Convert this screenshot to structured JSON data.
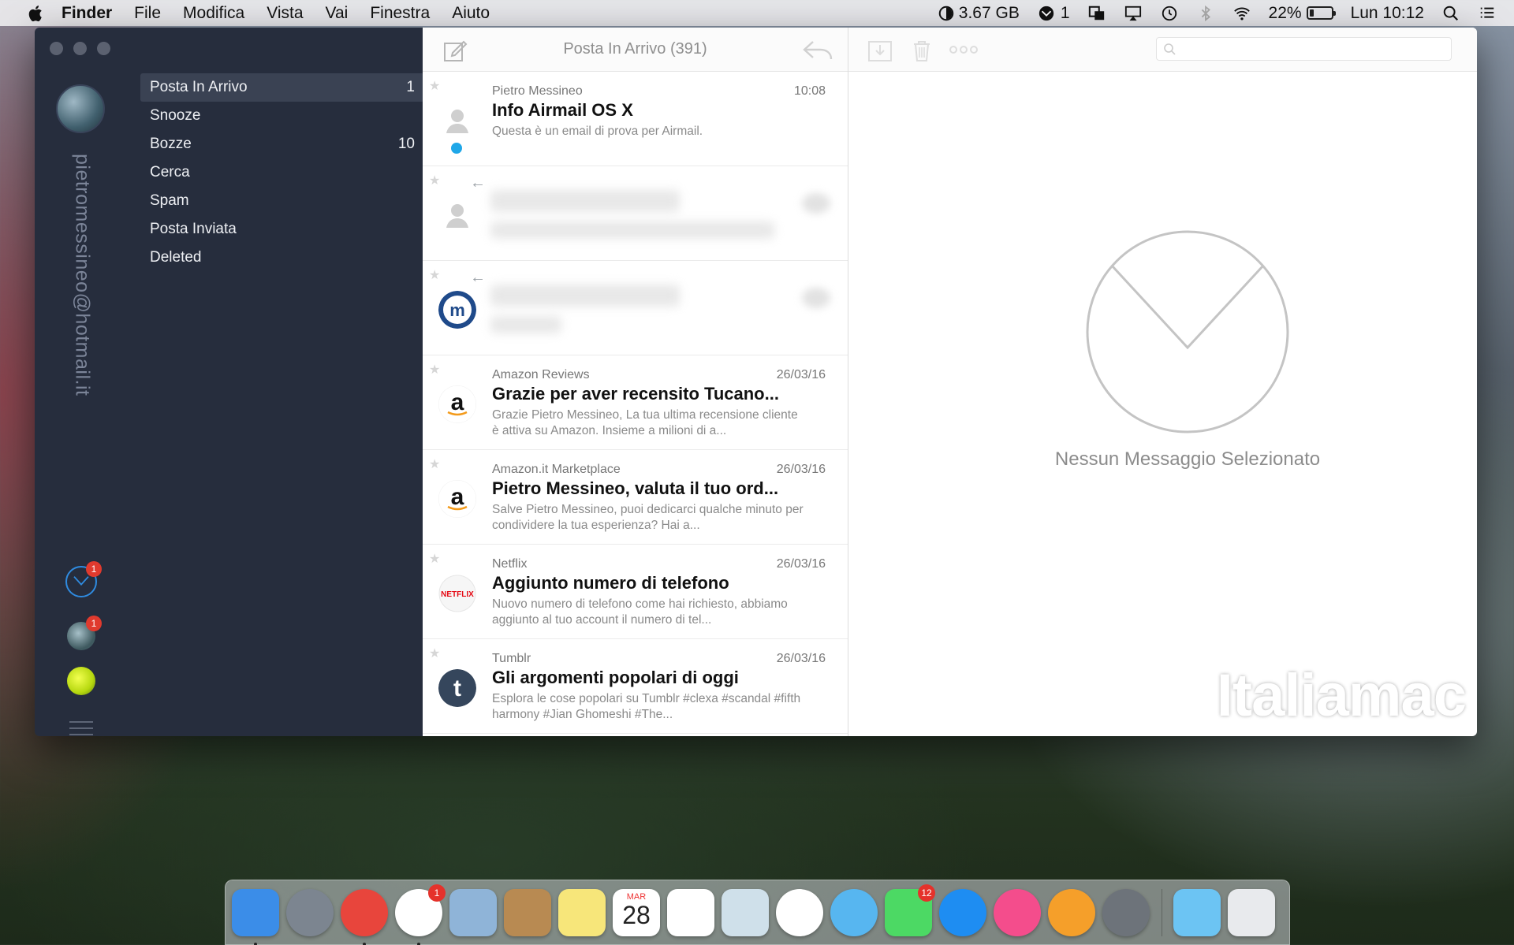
{
  "menubar": {
    "app_name": "Finder",
    "menus": [
      "File",
      "Modifica",
      "Vista",
      "Vai",
      "Finestra",
      "Aiuto"
    ],
    "memory": "3.67 GB",
    "airmail_count": "1",
    "battery": "22%",
    "battery_level": 0.22,
    "clock": "Lun 10:12",
    "icons": [
      "apple-icon",
      "memory-icon",
      "airmail-icon",
      "display-icon",
      "airplay-icon",
      "time-machine-icon",
      "bluetooth-icon",
      "wifi-icon",
      "battery-icon",
      "spotlight-icon",
      "notification-icon"
    ]
  },
  "accounts": {
    "email": "pietromessineo@hotmail.it",
    "items": [
      {
        "name": "airmail",
        "badge": "1"
      },
      {
        "name": "photo",
        "badge": "1"
      },
      {
        "name": "tennis",
        "badge": ""
      }
    ]
  },
  "folders": [
    {
      "label": "Posta In Arrivo",
      "count": "1",
      "active": true
    },
    {
      "label": "Snooze",
      "count": ""
    },
    {
      "label": "Bozze",
      "count": "10"
    },
    {
      "label": "Cerca",
      "count": ""
    },
    {
      "label": "Spam",
      "count": ""
    },
    {
      "label": "Posta Inviata",
      "count": ""
    },
    {
      "label": "Deleted",
      "count": ""
    }
  ],
  "message_list": {
    "title": "Posta In Arrivo (391)",
    "messages": [
      {
        "sender": "Pietro Messineo",
        "date": "10:08",
        "subject": "Info Airmail OS X",
        "preview": "Questa è un email di prova per Airmail.",
        "avatar": "person"
      },
      {
        "blurred": true,
        "avatar": "person"
      },
      {
        "blurred": true,
        "avatar": "logo"
      },
      {
        "sender": "Amazon Reviews",
        "date": "26/03/16",
        "subject": "Grazie per aver recensito Tucano...",
        "preview": "Grazie Pietro Messineo, La tua ultima recensione cliente è attiva su Amazon. Insieme a milioni di a...",
        "avatar": "amazon"
      },
      {
        "sender": "Amazon.it Marketplace",
        "date": "26/03/16",
        "subject": "Pietro Messineo, valuta il tuo ord...",
        "preview": "Salve Pietro Messineo, puoi dedicarci qualche minuto per condividere la tua esperienza? Hai a...",
        "avatar": "amazon"
      },
      {
        "sender": "Netflix",
        "date": "26/03/16",
        "subject": "Aggiunto numero di telefono",
        "preview": "Nuovo numero di telefono come hai richiesto, abbiamo aggiunto al tuo account il numero di tel...",
        "avatar": "netflix",
        "avatar_text": "NETFLIX"
      },
      {
        "sender": "Tumblr",
        "date": "26/03/16",
        "subject": "Gli argomenti popolari di oggi",
        "preview": "Esplora le cose popolari su Tumblr #clexa #scandal #fifth harmony #Jian Ghomeshi #The...",
        "avatar": "tumblr",
        "avatar_text": "t"
      }
    ]
  },
  "reader": {
    "empty_text": "Nessun Messaggio Selezionato",
    "watermark": "Italiamac"
  },
  "dock": {
    "items": [
      {
        "name": "finder",
        "color": "#3b8de8",
        "running": true
      },
      {
        "name": "launchpad",
        "color": "#7c8590"
      },
      {
        "name": "chrome",
        "color": "#e8453c",
        "running": true
      },
      {
        "name": "airmail",
        "color": "#ffffff",
        "badge": "1",
        "running": true
      },
      {
        "name": "mail",
        "color": "#8fb4d8"
      },
      {
        "name": "contacts",
        "color": "#b88a52"
      },
      {
        "name": "notes",
        "color": "#f7e67a"
      },
      {
        "name": "calendar",
        "color": "#ffffff",
        "month": "MAR",
        "day": "28"
      },
      {
        "name": "reminders",
        "color": "#ffffff"
      },
      {
        "name": "preview",
        "color": "#cfe0ea"
      },
      {
        "name": "photos",
        "color": "#ffffff"
      },
      {
        "name": "messages",
        "color": "#57b6f0"
      },
      {
        "name": "facetime",
        "color": "#4cd964",
        "badge": "12"
      },
      {
        "name": "app-store",
        "color": "#1e8df2"
      },
      {
        "name": "itunes",
        "color": "#f44d8c"
      },
      {
        "name": "ibooks",
        "color": "#f59f2a"
      },
      {
        "name": "system-preferences",
        "color": "#6d737a"
      },
      {
        "name": "downloads-folder",
        "color": "#6cc4f3"
      },
      {
        "name": "trash",
        "color": "#e8eaed"
      }
    ]
  }
}
